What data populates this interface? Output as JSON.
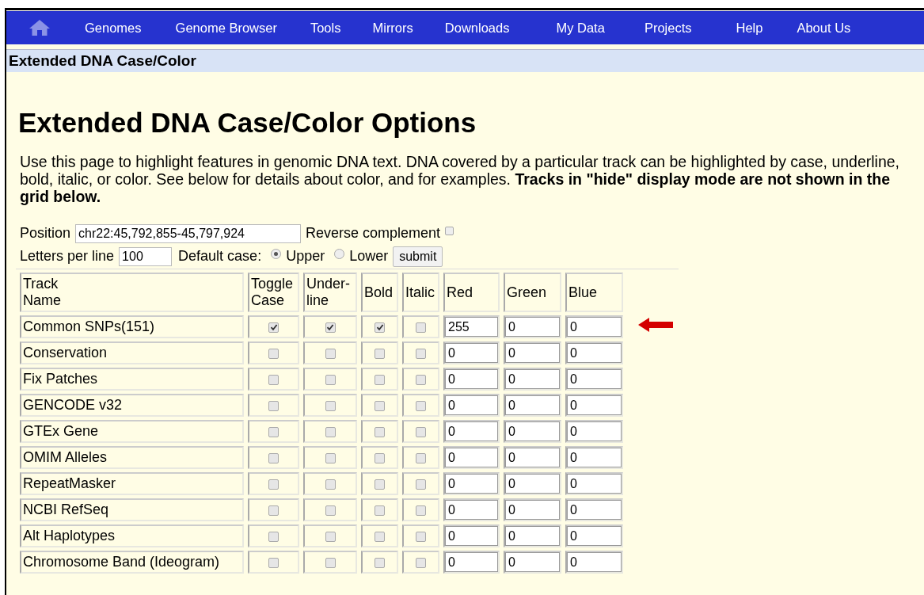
{
  "nav": {
    "items": [
      "Genomes",
      "Genome Browser",
      "Tools",
      "Mirrors",
      "Downloads",
      "My Data",
      "Projects",
      "Help",
      "About Us"
    ]
  },
  "section_title": "Extended DNA Case/Color",
  "heading": "Extended DNA Case/Color Options",
  "intro": "Use this page to highlight features in genomic DNA text. DNA covered by a particular track can be highlighted by case, underline,\nbold, italic, or color. See below for details about color, and for examples. **Tracks in \"hide\" display mode are not shown in the\ngrid below.**",
  "form": {
    "position_label": "Position",
    "position_value": "chr22:45,792,855-45,797,924",
    "reverse_label": "Reverse complement",
    "reverse_checked": false,
    "letters_label": "Letters per line",
    "letters_value": "100",
    "case_label": "Default case:",
    "case_options": [
      {
        "label": "Upper",
        "selected": true
      },
      {
        "label": "Lower",
        "selected": false
      }
    ],
    "submit": "submit"
  },
  "table": {
    "columns": [
      "Track\nName",
      "Toggle\nCase",
      "Under-\nline",
      "Bold",
      "Italic",
      "Red",
      "Green",
      "Blue"
    ],
    "rows": [
      {
        "name": "Common SNPs(151)",
        "toggle_case": true,
        "underline": true,
        "bold": true,
        "italic": false,
        "red": "255",
        "green": "0",
        "blue": "0"
      },
      {
        "name": "Conservation",
        "toggle_case": false,
        "underline": false,
        "bold": false,
        "italic": false,
        "red": "0",
        "green": "0",
        "blue": "0"
      },
      {
        "name": "Fix Patches",
        "toggle_case": false,
        "underline": false,
        "bold": false,
        "italic": false,
        "red": "0",
        "green": "0",
        "blue": "0"
      },
      {
        "name": "GENCODE v32",
        "toggle_case": false,
        "underline": false,
        "bold": false,
        "italic": false,
        "red": "0",
        "green": "0",
        "blue": "0"
      },
      {
        "name": "GTEx Gene",
        "toggle_case": false,
        "underline": false,
        "bold": false,
        "italic": false,
        "red": "0",
        "green": "0",
        "blue": "0"
      },
      {
        "name": "OMIM Alleles",
        "toggle_case": false,
        "underline": false,
        "bold": false,
        "italic": false,
        "red": "0",
        "green": "0",
        "blue": "0"
      },
      {
        "name": "RepeatMasker",
        "toggle_case": false,
        "underline": false,
        "bold": false,
        "italic": false,
        "red": "0",
        "green": "0",
        "blue": "0"
      },
      {
        "name": "NCBI RefSeq",
        "toggle_case": false,
        "underline": false,
        "bold": false,
        "italic": false,
        "red": "0",
        "green": "0",
        "blue": "0"
      },
      {
        "name": "Alt Haplotypes",
        "toggle_case": false,
        "underline": false,
        "bold": false,
        "italic": false,
        "red": "0",
        "green": "0",
        "blue": "0"
      },
      {
        "name": "Chromosome Band (Ideogram)",
        "toggle_case": false,
        "underline": false,
        "bold": false,
        "italic": false,
        "red": "0",
        "green": "0",
        "blue": "0"
      }
    ]
  }
}
